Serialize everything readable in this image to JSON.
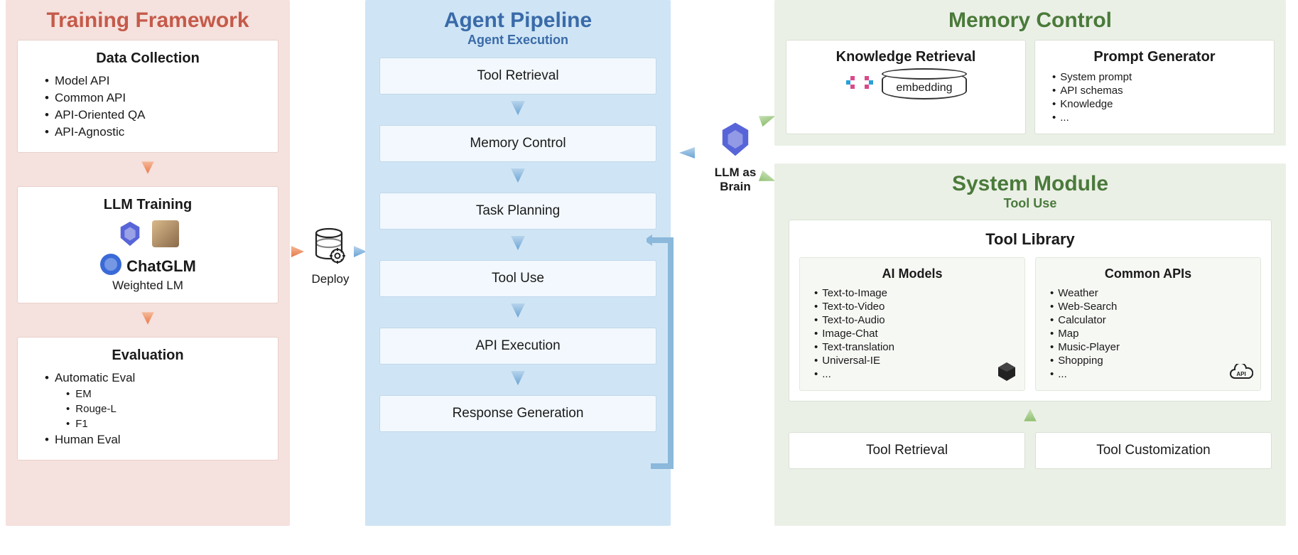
{
  "trainingFramework": {
    "title": "Training Framework",
    "dataCollection": {
      "title": "Data Collection",
      "items": [
        "Model API",
        "Common API",
        "API-Oriented QA",
        "API-Agnostic"
      ]
    },
    "llmTraining": {
      "title": "LLM Training",
      "chatglm": "ChatGLM",
      "weightedLM": "Weighted LM"
    },
    "evaluation": {
      "title": "Evaluation",
      "items": [
        {
          "label": "Automatic Eval",
          "sub": [
            "EM",
            "Rouge-L",
            "F1"
          ]
        },
        {
          "label": "Human Eval"
        }
      ]
    }
  },
  "deploy": {
    "label": "Deploy"
  },
  "agentPipeline": {
    "title": "Agent Pipeline",
    "subtitle": "Agent Execution",
    "steps": [
      "Tool Retrieval",
      "Memory Control",
      "Task Planning",
      "Tool Use",
      "API Execution",
      "Response Generation"
    ]
  },
  "brain": {
    "label1": "LLM as",
    "label2": "Brain"
  },
  "memoryControl": {
    "title": "Memory Control",
    "knowledgeRetrieval": {
      "title": "Knowledge Retrieval",
      "embedding": "embedding"
    },
    "promptGenerator": {
      "title": "Prompt Generator",
      "items": [
        "System prompt",
        "API schemas",
        "Knowledge",
        "..."
      ]
    }
  },
  "systemModule": {
    "title": "System Module",
    "subtitle": "Tool Use",
    "toolLibrary": {
      "title": "Tool Library",
      "aiModels": {
        "title": "AI Models",
        "items": [
          "Text-to-Image",
          "Text-to-Video",
          "Text-to-Audio",
          "Image-Chat",
          "Text-translation",
          "Universal-IE",
          "..."
        ]
      },
      "commonAPIs": {
        "title": "Common APIs",
        "items": [
          "Weather",
          "Web-Search",
          "Calculator",
          "Map",
          "Music-Player",
          "Shopping",
          "..."
        ]
      }
    },
    "toolRetrieval": "Tool Retrieval",
    "toolCustomization": "Tool Customization"
  }
}
